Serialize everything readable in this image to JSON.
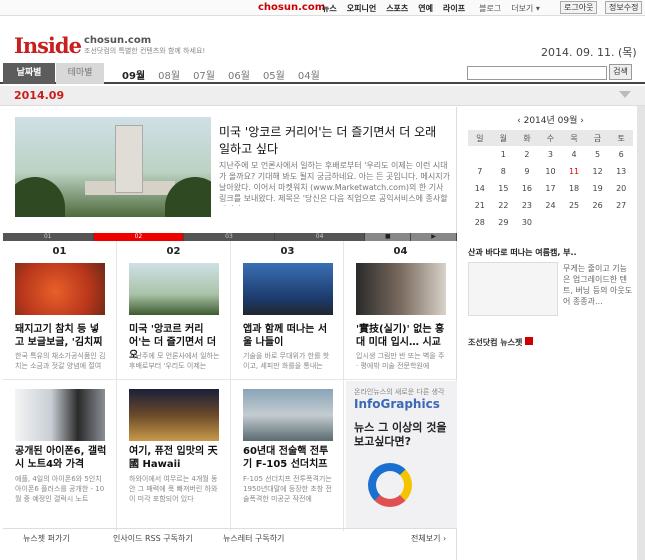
{
  "topbar": {
    "logo": "chosun.com",
    "nav": [
      "뉴스",
      "오피니언",
      "스포츠",
      "연예",
      "라이프"
    ],
    "nav_light": [
      "블로그",
      "더보기 ▾"
    ],
    "login": "로그아웃",
    "profile": "정보수정"
  },
  "brand": {
    "title": "Inside",
    "site": "chosun.com",
    "tagline": "조선닷컴의 특별한 컨텐츠와 함께 하세요!"
  },
  "date": "2014. 09. 11. (목)",
  "tabs": {
    "active": "날짜별",
    "inactive": "테마별"
  },
  "months": [
    "09월",
    "08월",
    "07월",
    "06월",
    "05월",
    "04월"
  ],
  "search": {
    "button": "검색",
    "placeholder": ""
  },
  "month_label": "2014.09",
  "featured": {
    "title": "미국 '앙코르 커리어'는 더 즐기면서 더 오래 일하고 싶다",
    "desc": "지난주에 모 언론사에서 일하는 후배로부터 '우리도 이제는 이런 시대가 올까요? 기대해 봐도 될지 궁금하네요. 아는 든 곳입니다. 메시지가 날아왔다. 이어서 마켓워치 (www.Marketwatch.com)의 한 기사 링크를 보내왔다. 제목은 '당신은 다음 직업으로 공익서비스에 종사할 것인가?'(Will"
  },
  "pager": [
    "01",
    "02",
    "03",
    "04"
  ],
  "cards_row1": [
    {
      "num": "01",
      "title": "돼지고기 참치 등 넣고 보글보글, '김치찌",
      "desc": "한국 특유의 채소가공식품인 김치는 소금과 젓갈 양념에 절여"
    },
    {
      "num": "02",
      "title": "미국 '앙코르 커리어'는 더 즐기면서 더 오",
      "desc": "지난주에 모 언론사에서 일하는 후배로부터 '우리도 이제는"
    },
    {
      "num": "03",
      "title": "앱과 함께 떠나는 서울 나들이",
      "desc": "기술을 바로 무대위가 한를 핫이고, 세피만 화를을 통내는"
    },
    {
      "num": "04",
      "title": "'實技(실기)' 없는 홍대 미대 입시… 시교",
      "desc": "입시생 그림만 반 또는 벽을 주 · 평에밖 미술 전문학원에"
    }
  ],
  "cards_row2": [
    {
      "title": "공개된 아이폰6, 갤럭시 노트4와 가격",
      "desc": "애플, 4일의 아이폰6와 5인치 아이폰6 플러스를 공개한 - 10월 중 예정인 갤럭시 노트"
    },
    {
      "title": "여기, 퓨전 입맛의 天國 Hawaii",
      "desc": "하와이에서 여무르는 4개월 동안 그 매력에 푹 빠져버린 하와이 미각 포함되어 있다"
    },
    {
      "title": "60년대 전술핵 전투기 F-105 선더치프",
      "desc": "F-105 선더치프 전투폭격기는 1950년대말에 등장한 초창 전술폭격한 미공군 작전에"
    }
  ],
  "infographic": {
    "top": "온라인뉴스의 새로운 다른 생각",
    "brand": "InfoGraphics",
    "headline": "뉴스 그 이상의 것을 보고싶다면?"
  },
  "footer": {
    "store": "뉴스젯 퍼가기",
    "rss": "인사이드 RSS 구독하기",
    "newsletter": "뉴스레터 구독하기",
    "all": "전체보기 ›"
  },
  "calendar": {
    "header": "‹ 2014년 09월 ›",
    "days": [
      "일",
      "월",
      "화",
      "수",
      "목",
      "금",
      "토"
    ],
    "weeks": [
      [
        "",
        "1",
        "2",
        "3",
        "4",
        "5",
        "6"
      ],
      [
        "7",
        "8",
        "9",
        "10",
        "11",
        "12",
        "13"
      ],
      [
        "14",
        "15",
        "16",
        "17",
        "18",
        "19",
        "20"
      ],
      [
        "21",
        "22",
        "23",
        "24",
        "25",
        "26",
        "27"
      ],
      [
        "28",
        "29",
        "30",
        "",
        "",
        "",
        ""
      ]
    ]
  },
  "side": {
    "headline": "산과 바다로 떠나는 여름캠, 부..",
    "text": "무게는 줄이고 기능은 업그레이드한 텐트, 버닝 등의 아웃도어 종종과...",
    "news": "조선닷컴 뉴스젯"
  },
  "colors": {
    "accent": "#c81e1e",
    "tab_active": "#5c5c5c"
  }
}
